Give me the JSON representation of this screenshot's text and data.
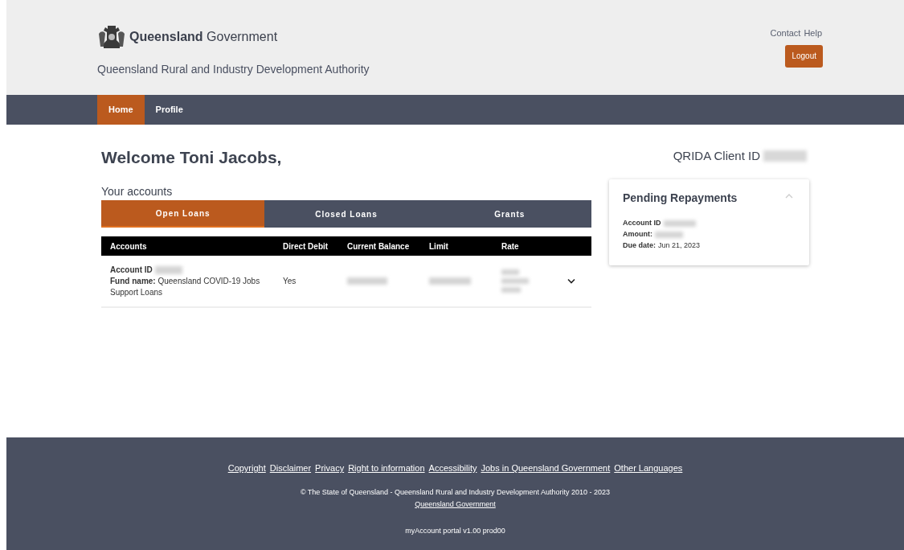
{
  "header": {
    "logo_bold": "Queensland",
    "logo_light": "Government",
    "subtitle": "Queensland Rural and Industry Development Authority",
    "links": [
      "Contact",
      "Help"
    ],
    "logout": "Logout"
  },
  "nav": [
    {
      "label": "Home",
      "selected": true
    },
    {
      "label": "Profile",
      "selected": false
    }
  ],
  "welcome": "Welcome Toni Jacobs,",
  "client_id_label": "QRIDA Client ID",
  "accounts_heading": "Your accounts",
  "account_tabs": [
    {
      "label": "Open Loans",
      "selected": true
    },
    {
      "label": "Closed Loans",
      "selected": false
    },
    {
      "label": "Grants",
      "selected": false
    }
  ],
  "table": {
    "columns": [
      "Accounts",
      "Direct Debit",
      "Current Balance",
      "Limit",
      "Rate"
    ],
    "rows": [
      {
        "account_id_label": "Account ID",
        "fund_name_label": "Fund name:",
        "fund_name": "Queensland COVID-19 Jobs Support Loans",
        "direct_debit": "Yes",
        "expanded": false
      }
    ]
  },
  "pending": {
    "title": "Pending Repayments",
    "expanded": true,
    "fields": [
      {
        "label": "Account ID"
      },
      {
        "label": "Amount:"
      },
      {
        "label": "Due date:",
        "value": "Jun 21, 2023"
      }
    ]
  },
  "footer": {
    "links": [
      "Copyright",
      "Disclaimer",
      "Privacy",
      "Right to information",
      "Accessibility",
      "Jobs in Queensland Government",
      "Other Languages"
    ],
    "copyright": "© The State of Queensland - Queensland Rural and Industry Development Authority 2010 - 2023",
    "gov_link": "Queensland Government",
    "version": "myAccount portal v1.00 prod00"
  }
}
